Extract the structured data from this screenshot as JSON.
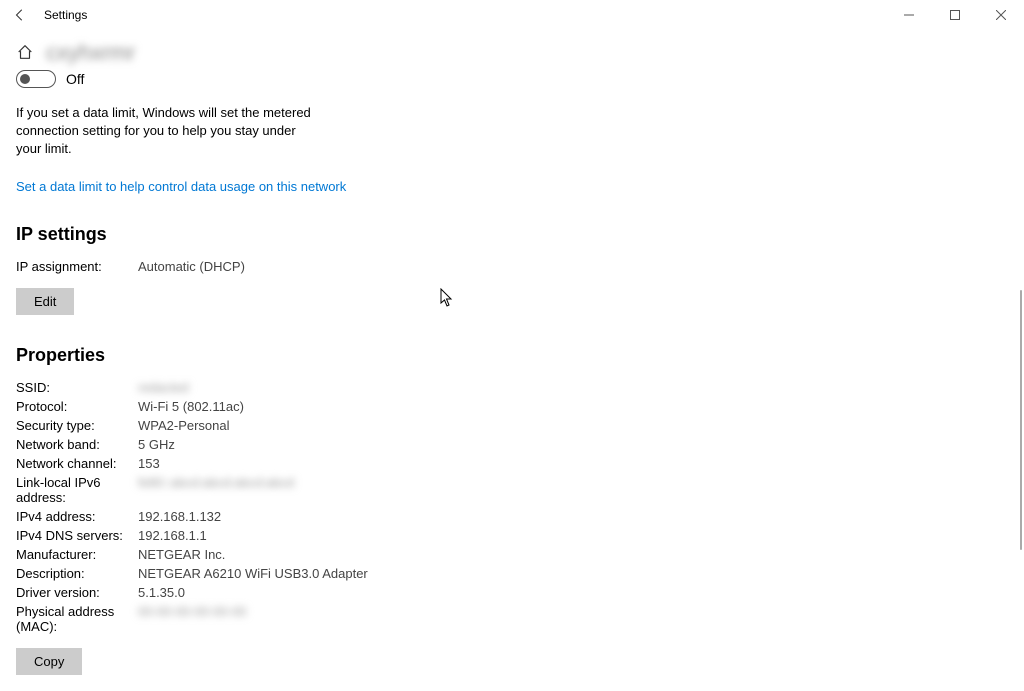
{
  "titlebar": {
    "title": "Settings"
  },
  "network": {
    "name": "cxyhxrmr",
    "toggle_label": "Off"
  },
  "metered": {
    "description": "If you set a data limit, Windows will set the metered connection setting for you to help you stay under your limit.",
    "link": "Set a data limit to help control data usage on this network"
  },
  "ip_settings": {
    "heading": "IP settings",
    "assignment_label": "IP assignment:",
    "assignment_value": "Automatic (DHCP)",
    "edit_button": "Edit"
  },
  "properties": {
    "heading": "Properties",
    "rows": [
      {
        "key": "SSID:",
        "value": "redacted",
        "blurred": true
      },
      {
        "key": "Protocol:",
        "value": "Wi-Fi 5 (802.11ac)"
      },
      {
        "key": "Security type:",
        "value": "WPA2-Personal"
      },
      {
        "key": "Network band:",
        "value": "5 GHz"
      },
      {
        "key": "Network channel:",
        "value": "153"
      },
      {
        "key": "Link-local IPv6 address:",
        "value": "fe80::abcd:abcd:abcd:abcd",
        "blurred": true
      },
      {
        "key": "IPv4 address:",
        "value": "192.168.1.132"
      },
      {
        "key": "IPv4 DNS servers:",
        "value": "192.168.1.1"
      },
      {
        "key": "Manufacturer:",
        "value": "NETGEAR Inc."
      },
      {
        "key": "Description:",
        "value": "NETGEAR A6210 WiFi USB3.0 Adapter"
      },
      {
        "key": "Driver version:",
        "value": "5.1.35.0"
      },
      {
        "key": "Physical address (MAC):",
        "value": "00-00-00-00-00-00",
        "blurred": true
      }
    ],
    "copy_button": "Copy"
  }
}
